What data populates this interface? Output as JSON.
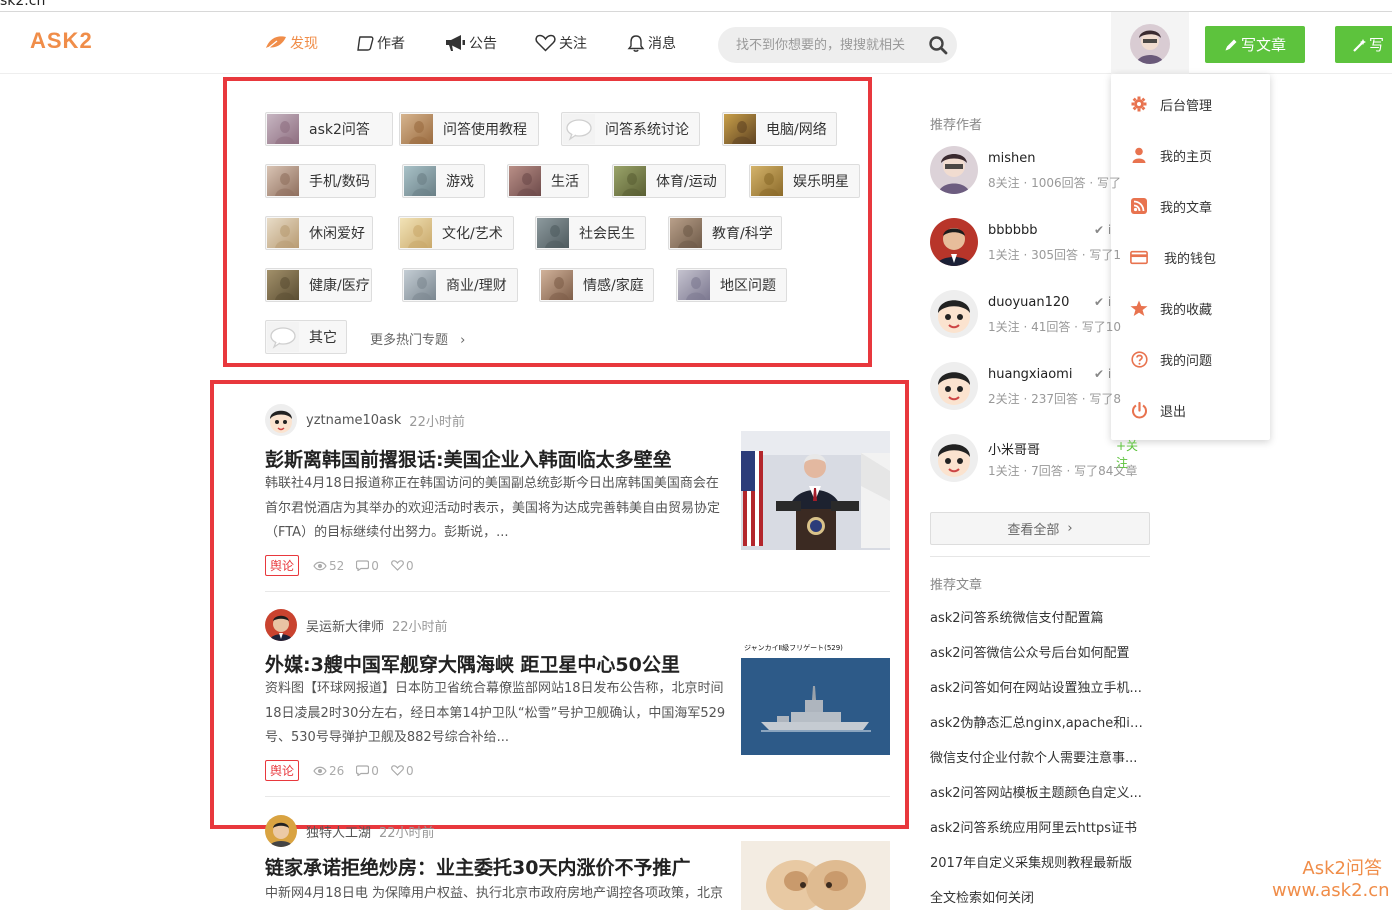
{
  "browser": {
    "url_fragment": "sk2.cn"
  },
  "header": {
    "logo": "ASK2",
    "nav": [
      {
        "label": "发现",
        "icon": "leaf-icon",
        "active": true
      },
      {
        "label": "作者",
        "icon": "bubble-icon",
        "active": false
      },
      {
        "label": "公告",
        "icon": "megaphone-icon",
        "active": false
      },
      {
        "label": "关注",
        "icon": "heart-icon",
        "active": false
      },
      {
        "label": "消息",
        "icon": "bell-icon",
        "active": false
      }
    ],
    "search_placeholder": "找不到你想要的，搜搜就相关",
    "write_article": "写文章",
    "write_short": "写"
  },
  "dropdown": {
    "items": [
      {
        "label": "后台管理",
        "icon": "gear-icon"
      },
      {
        "label": "我的主页",
        "icon": "user-icon"
      },
      {
        "label": "我的文章",
        "icon": "rss-icon"
      },
      {
        "label": "我的钱包",
        "icon": "card-icon"
      },
      {
        "label": "我的收藏",
        "icon": "star-icon"
      },
      {
        "label": "我的问题",
        "icon": "question-icon"
      },
      {
        "label": "退出",
        "icon": "power-icon"
      }
    ]
  },
  "topics": {
    "items": [
      "ask2问答",
      "问答使用教程",
      "问答系统讨论",
      "电脑/网络",
      "手机/数码",
      "游戏",
      "生活",
      "体育/运动",
      "娱乐明星",
      "休闲爱好",
      "文化/艺术",
      "社会民生",
      "教育/科学",
      "健康/医疗",
      "商业/理财",
      "情感/家庭",
      "地区问题",
      "其它"
    ],
    "more": "更多热门专题"
  },
  "articles": [
    {
      "author": "yztname10ask",
      "time": "22小时前",
      "title": "彭斯离韩国前撂狠话:美国企业入韩面临太多壁垒",
      "body": "韩联社4月18日报道称正在韩国访问的美国副总统彭斯今日出席韩国美国商会在首尔君悦酒店为其举办的欢迎活动时表示，美国将为达成完善韩美自由贸易协定（FTA）的目标继续付出努力。彭斯说，...",
      "tag": "舆论",
      "views": "52",
      "comments": "0",
      "likes": "0"
    },
    {
      "author": "吴运新大律师",
      "time": "22小时前",
      "title": "外媒:3艘中国军舰穿大隅海峡 距卫星中心50公里",
      "body": "资料图【环球网报道】日本防卫省统合幕僚监部网站18日发布公告称，北京时间18日凌晨2时30分左右，经日本第14护卫队“松雪”号护卫舰确认，中国海军529号、530号导弹护卫舰及882号综合补给...",
      "tag": "舆论",
      "views": "26",
      "comments": "0",
      "likes": "0",
      "image_caption": "ジャンカイⅡ級フリゲート(529)"
    },
    {
      "author": "独特人工湖",
      "time": "22小时前",
      "title": "链家承诺拒绝炒房：业主委托30天内涨价不予推广",
      "body": "中新网4月18日电 为保障用户权益、执行北京市政府房地产调控各项政策，北京"
    }
  ],
  "sidebar": {
    "authors_heading": "推荐作者",
    "authors": [
      {
        "name": "mishen",
        "stats": "8关注 · 1006回答 · 写了",
        "mark": ""
      },
      {
        "name": "bbbbbb",
        "stats": "1关注 · 305回答 · 写了1",
        "mark": "✔ i"
      },
      {
        "name": "duoyuan120",
        "stats": "1关注 · 41回答 · 写了10",
        "mark": "✔ i"
      },
      {
        "name": "huangxiaomi",
        "stats": "2关注 · 237回答 · 写了8",
        "mark": "✔ i"
      },
      {
        "name": "小米哥哥",
        "stats": "1关注 · 7回答 · 写了84文章",
        "mark": "+关注"
      }
    ],
    "view_all": "查看全部",
    "articles_heading": "推荐文章",
    "rec_articles": [
      "ask2问答系统微信支付配置篇",
      "ask2问答微信公众号后台如何配置",
      "ask2问答如何在网站设置独立手机...",
      "ask2伪静态汇总nginx,apache和iis...",
      "微信支付企业付款个人需要注意事...",
      "ask2问答网站模板主题颜色自定义...",
      "ask2问答系统应用阿里云https证书",
      "2017年自定义采集规则教程最新版",
      "全文检索如何关闭"
    ]
  },
  "watermark": {
    "line1": "Ask2问答",
    "line2": "www.ask2.cn"
  },
  "colors": {
    "brand": "#f08d49",
    "green": "#5dc33d",
    "annotation_red": "#e8383d"
  }
}
